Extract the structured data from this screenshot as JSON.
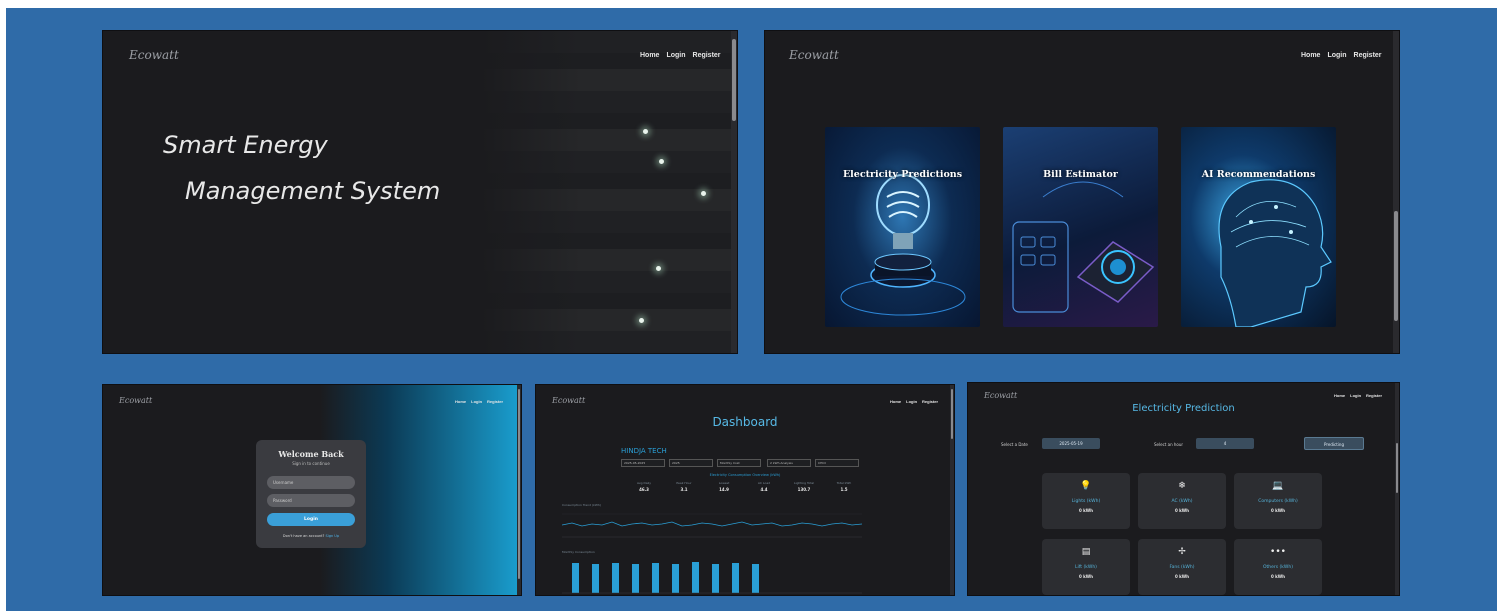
{
  "shot1": {
    "logo": "Ecowatt",
    "nav": [
      "Home",
      "Login",
      "Register"
    ],
    "hero_line1": "Smart Energy",
    "hero_line2": "Management System"
  },
  "shot2": {
    "logo": "Ecowatt",
    "nav": [
      "Home",
      "Login",
      "Register"
    ],
    "cards": [
      {
        "title": "Electricity Predictions"
      },
      {
        "title": "Bill Estimator"
      },
      {
        "title": "AI Recommendations"
      }
    ]
  },
  "shot3": {
    "logo": "Ecowatt",
    "nav": [
      "Home",
      "Login",
      "Register"
    ],
    "login": {
      "title": "Welcome Back",
      "subtitle": "Sign in to continue",
      "username_placeholder": "Username",
      "password_placeholder": "Password",
      "button": "Login",
      "footer": "Don't have an account?",
      "footer_link": "Sign Up"
    }
  },
  "shot4": {
    "logo": "Ecowatt",
    "nav": [
      "Home",
      "Login",
      "Register"
    ],
    "title": "Dashboard",
    "company": "HINDJA TECH",
    "filters": [
      "2025-05-2025",
      "2025",
      "Monthly Cost",
      "2 kWh Analysis",
      "CHOI"
    ],
    "summary_title": "Electricity Consumption Overview (kWh)",
    "stats": [
      {
        "label": "Avg Daily",
        "value": "46.3"
      },
      {
        "label": "Peak Hour",
        "value": "3.1"
      },
      {
        "label": "Lowest",
        "value": "14.9"
      },
      {
        "label": "AC Load",
        "value": "4.4"
      },
      {
        "label": "Lighting Total",
        "value": "130.7"
      },
      {
        "label": "Total kWh",
        "value": "1.5"
      }
    ],
    "line_chart_title": "Consumption Trend (kWh)",
    "bar_chart_title": "Monthly Consumption",
    "accent": "#2a9fd6"
  },
  "shot5": {
    "logo": "Ecowatt",
    "nav": [
      "Home",
      "Login",
      "Register"
    ],
    "title": "Electricity Prediction",
    "date_label": "Select a Date",
    "date_value": "2025-05-19",
    "hour_label": "Select an hour",
    "hour_value": "4",
    "predict_button": "Predicting",
    "appliances": [
      {
        "icon": "lightbulb-icon",
        "glyph": "💡",
        "name": "Lights (kWh)",
        "value": "0 kWh"
      },
      {
        "icon": "snowflake-icon",
        "glyph": "❄",
        "name": "AC (kWh)",
        "value": "0 kWh"
      },
      {
        "icon": "laptop-icon",
        "glyph": "💻",
        "name": "Computers (kWh)",
        "value": "0 kWh"
      },
      {
        "icon": "elevator-icon",
        "glyph": "▤",
        "name": "Lift (kWh)",
        "value": "0 kWh"
      },
      {
        "icon": "fan-icon",
        "glyph": "✢",
        "name": "Fans (kWh)",
        "value": "0 kWh"
      },
      {
        "icon": "more-icon",
        "glyph": "•••",
        "name": "Others (kWh)",
        "value": "0 kWh"
      }
    ]
  },
  "colors": {
    "frame": "#2f6ba8",
    "app_bg": "#1b1b1e",
    "accent_blue": "#2a9fd6"
  }
}
